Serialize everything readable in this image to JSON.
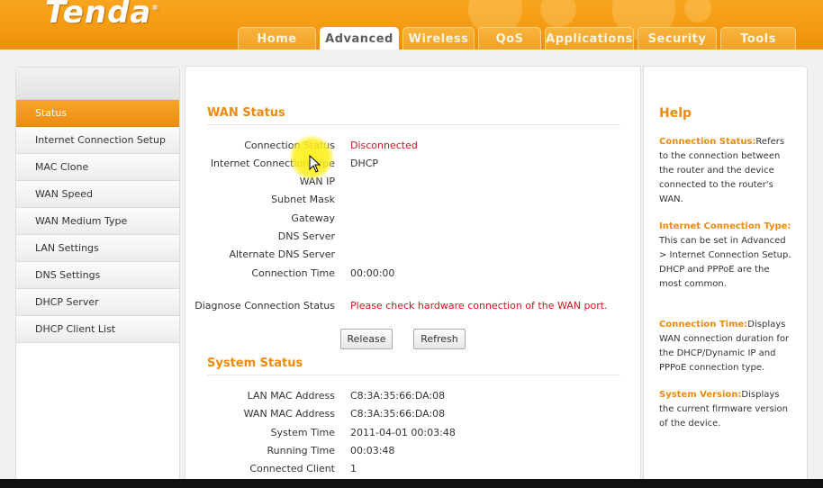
{
  "brand": {
    "logo": "Tenda",
    "reg_mark": "®"
  },
  "nav": {
    "tabs": [
      {
        "label": "Home",
        "active": false
      },
      {
        "label": "Advanced",
        "active": true
      },
      {
        "label": "Wireless",
        "active": false
      },
      {
        "label": "QoS",
        "active": false
      },
      {
        "label": "Applications",
        "active": false
      },
      {
        "label": "Security",
        "active": false
      },
      {
        "label": "Tools",
        "active": false
      }
    ]
  },
  "sidebar": {
    "items": [
      {
        "label": "Status",
        "active": true
      },
      {
        "label": "Internet Connection Setup",
        "active": false
      },
      {
        "label": "MAC Clone",
        "active": false
      },
      {
        "label": "WAN Speed",
        "active": false
      },
      {
        "label": "WAN Medium Type",
        "active": false
      },
      {
        "label": "LAN Settings",
        "active": false
      },
      {
        "label": "DNS Settings",
        "active": false
      },
      {
        "label": "DHCP Server",
        "active": false
      },
      {
        "label": "DHCP Client List",
        "active": false
      }
    ]
  },
  "wan_status": {
    "title": "WAN Status",
    "rows": [
      {
        "label": "Connection Status",
        "value": "Disconnected"
      },
      {
        "label": "Internet Connection Type",
        "value": "DHCP"
      },
      {
        "label": "WAN IP",
        "value": ""
      },
      {
        "label": "Subnet Mask",
        "value": ""
      },
      {
        "label": "Gateway",
        "value": ""
      },
      {
        "label": "DNS Server",
        "value": ""
      },
      {
        "label": "Alternate DNS Server",
        "value": ""
      },
      {
        "label": "Connection Time",
        "value": "00:00:00"
      }
    ],
    "diagnose": {
      "label": "Diagnose Connection Status",
      "value": "Please check hardware connection of the WAN port."
    },
    "buttons": {
      "release": "Release",
      "refresh": "Refresh"
    }
  },
  "system_status": {
    "title": "System Status",
    "rows": [
      {
        "label": "LAN MAC Address",
        "value": "C8:3A:35:66:DA:08"
      },
      {
        "label": "WAN MAC Address",
        "value": "C8:3A:35:66:DA:08"
      },
      {
        "label": "System Time",
        "value": "2011-04-01 00:03:48"
      },
      {
        "label": "Running Time",
        "value": "00:03:48"
      },
      {
        "label": "Connected Client",
        "value": "1"
      }
    ]
  },
  "help": {
    "title": "Help",
    "blocks": [
      {
        "term": "Connection Status:",
        "text": "Refers to the connection between the router and the device connected to the router's WAN."
      },
      {
        "term": "Internet Connection Type:",
        "text": "This can be set in Advanced > Internet Connection Setup. DHCP and PPPoE are the most common."
      },
      {
        "term": "Connection Time:",
        "text": "Displays WAN connection duration for the DHCP/Dynamic IP and PPPoE connection type."
      },
      {
        "term": "System Version:",
        "text": "Displays the current firmware version of the device."
      }
    ]
  },
  "colors": {
    "accent": "#ef8a0c",
    "header": "#f39a12",
    "error": "#d2141a"
  }
}
